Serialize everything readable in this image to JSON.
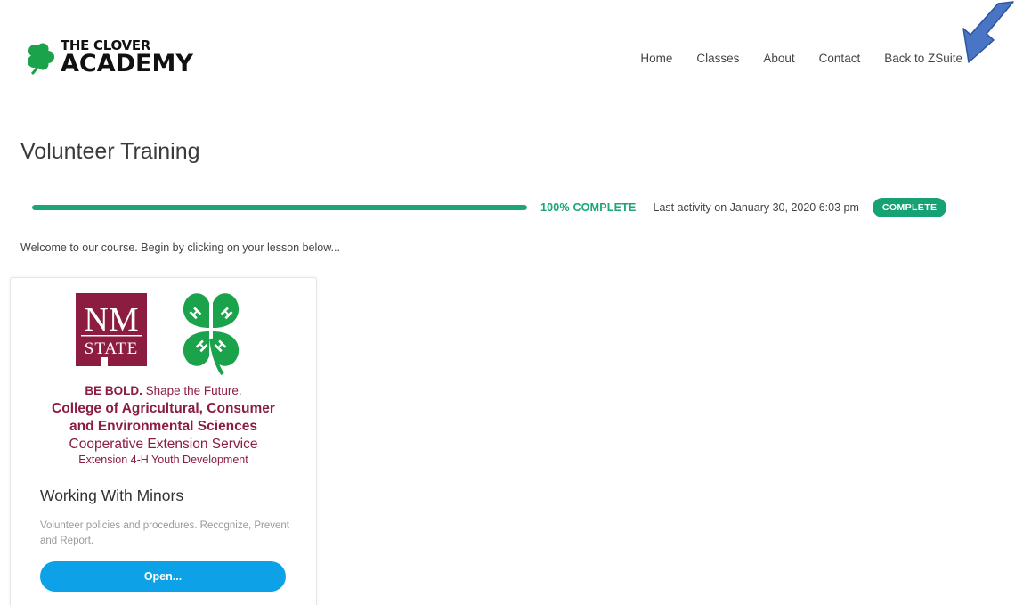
{
  "header": {
    "logo": {
      "line1": "THE CLOVER",
      "line2": "ACADEMY",
      "icon": "four-leaf-clover-icon"
    },
    "nav": [
      {
        "label": "Home"
      },
      {
        "label": "Classes"
      },
      {
        "label": "About"
      },
      {
        "label": "Contact"
      },
      {
        "label": "Back to ZSuite"
      }
    ],
    "annotation_icon": "arrow-down-left-icon"
  },
  "course": {
    "title": "Volunteer Training",
    "progress": {
      "percent": 100,
      "percent_label": "100% COMPLETE",
      "last_activity": "Last activity on January 30, 2020 6:03 pm",
      "status": "COMPLETE"
    },
    "intro": "Welcome to our course. Begin by clicking on your lesson below..."
  },
  "lesson": {
    "image": {
      "nm_logo_line1": "NM",
      "nm_logo_line2": "STATE",
      "clover_letter": "H",
      "tagline_bold": "BE BOLD.",
      "tagline_rest": " Shape the Future.",
      "college_line1": "College of Agricultural, Consumer",
      "college_line2": "and Environmental Sciences",
      "extension": "Cooperative Extension Service",
      "youth": "Extension 4-H Youth Development"
    },
    "title": "Working With Minors",
    "description": "Volunteer policies and procedures. Recognize, Prevent and Report.",
    "button_label": "Open..."
  },
  "colors": {
    "accent_green": "#1aa57a",
    "badge_green": "#16a274",
    "clover_green": "#1aa34a",
    "nmsu_crimson": "#8c1d40",
    "button_blue": "#0da2e8",
    "arrow_blue": "#4a74c4"
  }
}
